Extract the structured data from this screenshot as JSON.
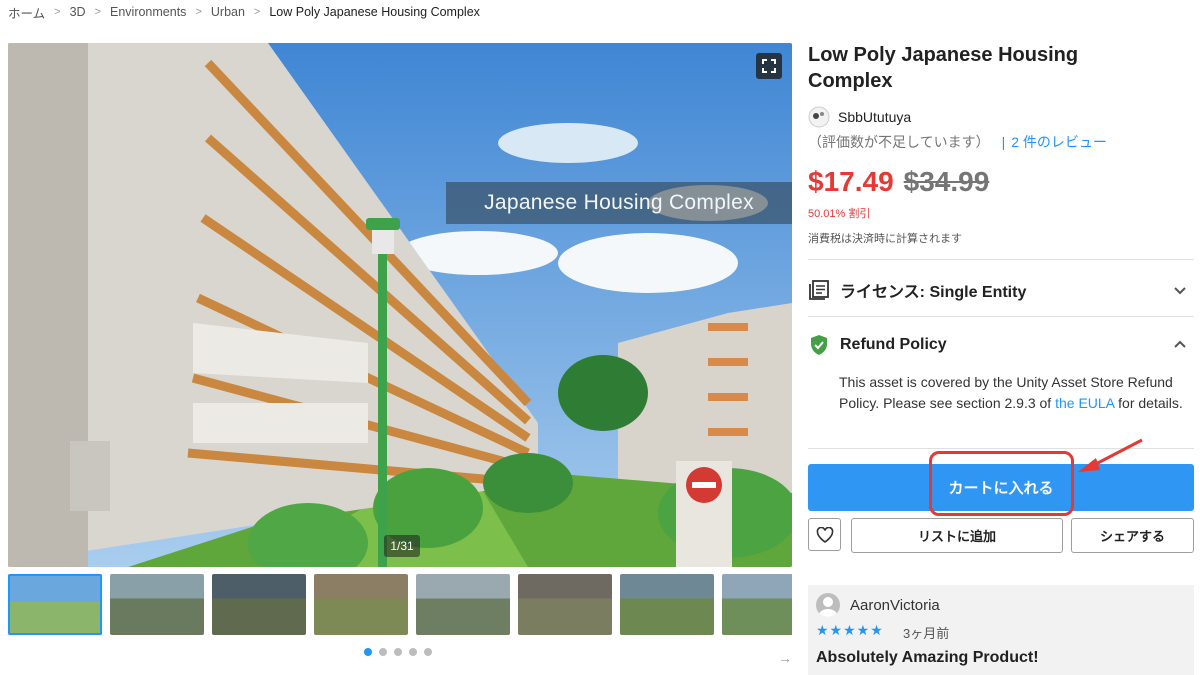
{
  "breadcrumb": [
    "ホーム",
    "3D",
    "Environments",
    "Urban",
    "Low Poly Japanese Housing Complex"
  ],
  "hero": {
    "overlay_title": "Japanese Housing Complex",
    "counter": "1/31"
  },
  "thumbnails": {
    "count": 8,
    "active_index": 0,
    "page_dots": 5,
    "active_dot": 0
  },
  "product": {
    "title": "Low Poly Japanese Housing Complex",
    "publisher": "SbbUtutuya",
    "rating_note": "（評価数が不足しています）",
    "divider": "|",
    "reviews_link": "2 件のレビュー",
    "price": "$17.49",
    "original_price": "$34.99",
    "discount": "50.01% 割引",
    "tax_note": "消費税は決済時に計算されます"
  },
  "license": {
    "label": "ライセンス: Single Entity"
  },
  "refund": {
    "label": "Refund Policy",
    "text_before": "This asset is covered by the Unity Asset Store Refund Policy. Please see section 2.9.3 of ",
    "link": "the EULA",
    "text_after": " for details."
  },
  "actions": {
    "add_to_cart": "カートに入れる",
    "add_to_list": "リストに追加",
    "share": "シェアする"
  },
  "review": {
    "user": "AaronVictoria",
    "stars": "★★★★★",
    "date": "3ヶ月前",
    "title": "Absolutely Amazing Product!"
  },
  "colors": {
    "accent": "#2f96f3",
    "price_red": "#e53935",
    "annotation_red": "#e53935",
    "shield_green": "#43a047"
  }
}
